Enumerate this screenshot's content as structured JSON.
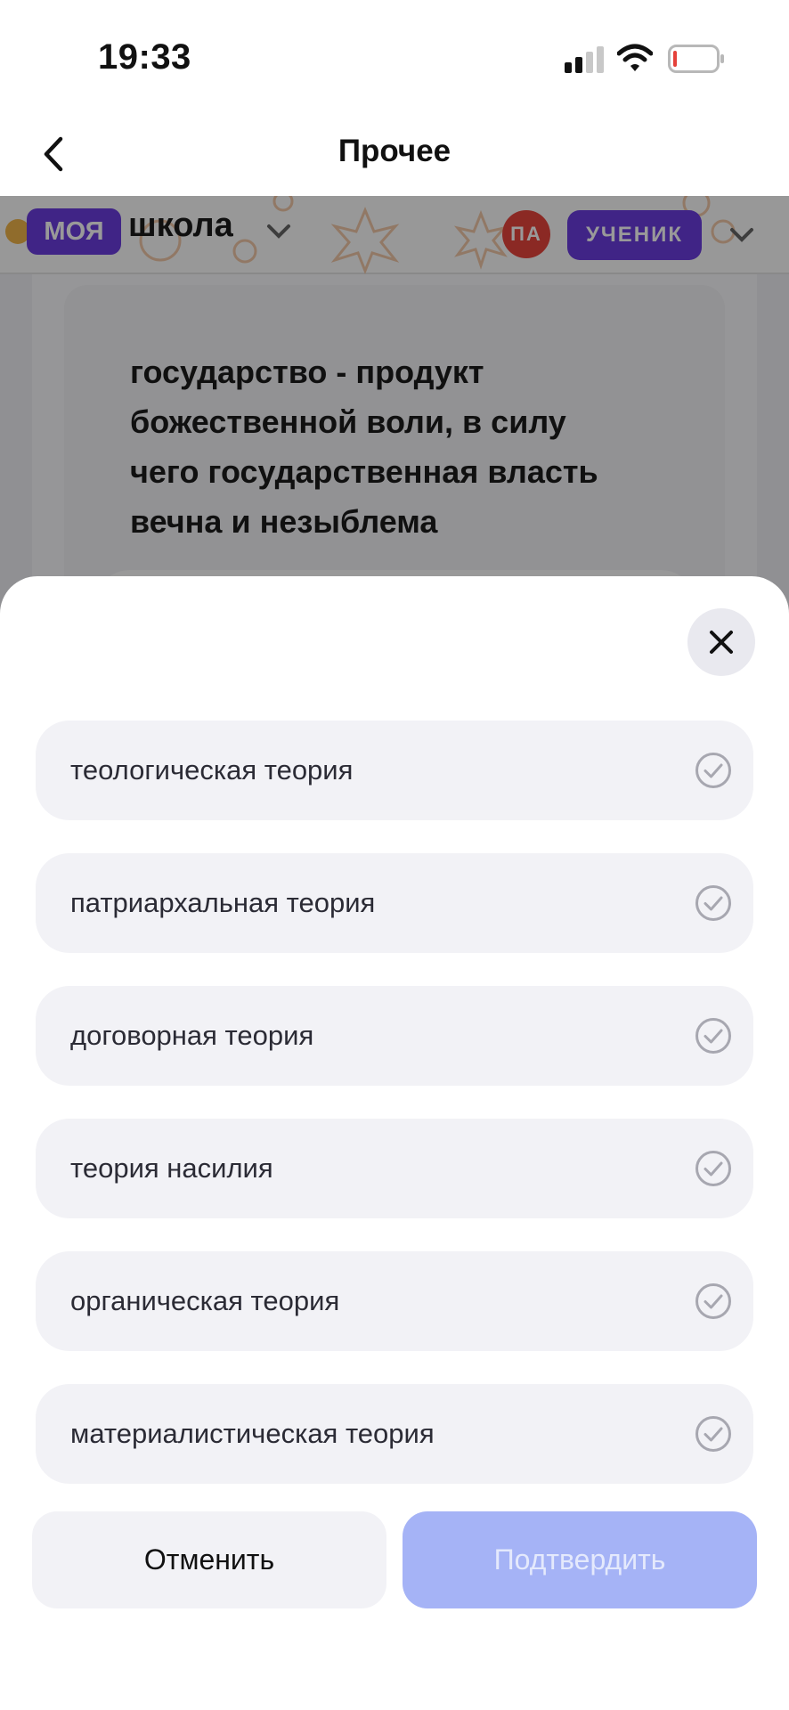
{
  "status_bar": {
    "time": "19:33",
    "icons": [
      "signal-icon",
      "wifi-icon",
      "battery-icon"
    ],
    "battery_color": "#e5413a"
  },
  "nav": {
    "title": "Прочее",
    "back_icon": "chevron-left-icon"
  },
  "web_page": {
    "logo_badge": "МОЯ",
    "logo_text": "школа",
    "avatar_initials": "ПА",
    "role": "УЧЕНИК",
    "question": "государство - продукт божественной воли, в силу чего государственная власть вечна и незыблема"
  },
  "sheet": {
    "close_icon": "close-icon",
    "options": [
      {
        "label": "теологическая теория",
        "icon": "check-circle-icon"
      },
      {
        "label": "патриархальная теория",
        "icon": "check-circle-icon"
      },
      {
        "label": "договорная теория",
        "icon": "check-circle-icon"
      },
      {
        "label": "теория насилия",
        "icon": "check-circle-icon"
      },
      {
        "label": "органическая теория",
        "icon": "check-circle-icon"
      },
      {
        "label": "материалистическая теория",
        "icon": "check-circle-icon"
      }
    ],
    "cancel_label": "Отменить",
    "confirm_label": "Подтвердить"
  },
  "colors": {
    "accent": "#6b3de0",
    "confirm_disabled": "#a5b3f6",
    "option_bg": "#f2f2f6",
    "avatar": "#e8453c"
  }
}
